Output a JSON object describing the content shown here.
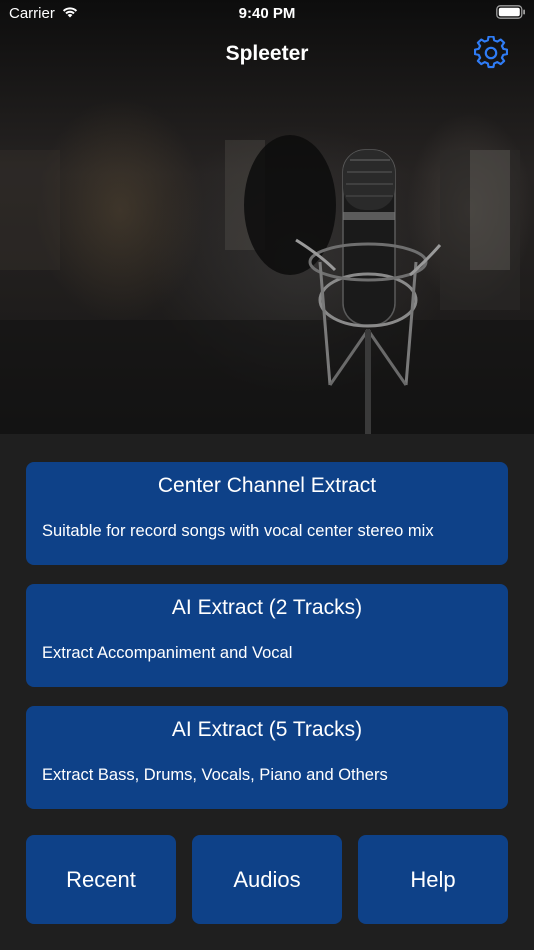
{
  "status_bar": {
    "carrier": "Carrier",
    "time": "9:40 PM"
  },
  "nav": {
    "title": "Spleeter",
    "settings_icon": "gear-icon"
  },
  "hero": {
    "image_subject": "studio condenser microphone"
  },
  "cards": [
    {
      "title": "Center Channel Extract",
      "description": "Suitable for record songs with vocal center stereo mix"
    },
    {
      "title": "AI Extract (2 Tracks)",
      "description": "Extract Accompaniment and Vocal"
    },
    {
      "title": "AI Extract (5 Tracks)",
      "description": "Extract Bass, Drums, Vocals, Piano and Others"
    }
  ],
  "bottom_buttons": {
    "recent": "Recent",
    "audios": "Audios",
    "help": "Help"
  },
  "colors": {
    "accent": "#2f7cf6",
    "button_bg": "#0e4188",
    "page_bg": "#1f1f1f"
  }
}
